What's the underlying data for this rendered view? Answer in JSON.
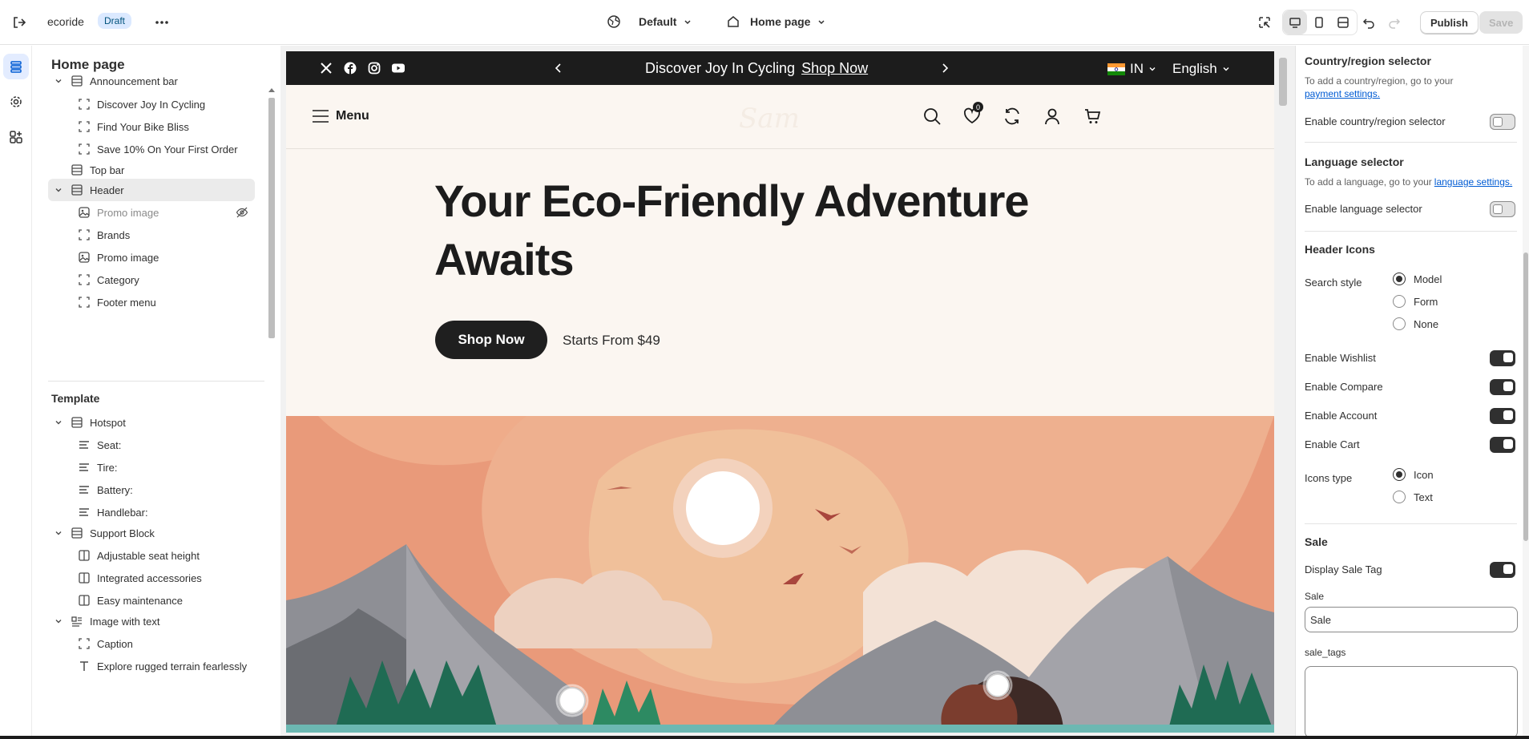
{
  "topbar": {
    "store_name": "ecoride",
    "status_badge": "Draft",
    "theme_selector": "Default",
    "page_selector": "Home page",
    "publish_label": "Publish",
    "save_label": "Save"
  },
  "rail": {
    "icons": [
      "sections-icon",
      "settings-gear-icon",
      "apps-icon"
    ]
  },
  "tree": {
    "title": "Home page",
    "header_group": [
      {
        "label": "Announcement bar",
        "level": 1,
        "expanded": true,
        "icon": "section-icon"
      },
      {
        "label": "Discover Joy In Cycling",
        "level": 2,
        "icon": "block-icon"
      },
      {
        "label": "Find Your Bike Bliss",
        "level": 2,
        "icon": "block-icon"
      },
      {
        "label": "Save 10% On Your First Order",
        "level": 2,
        "icon": "block-icon"
      },
      {
        "label": "Top bar",
        "level": 1,
        "icon": "section-icon"
      },
      {
        "label": "Header",
        "level": 1,
        "expanded": true,
        "selected": true,
        "icon": "section-icon"
      },
      {
        "label": "Promo image",
        "level": 2,
        "hidden": true,
        "icon": "image-icon"
      },
      {
        "label": "Brands",
        "level": 2,
        "icon": "block-icon"
      },
      {
        "label": "Promo image",
        "level": 2,
        "icon": "image-icon"
      },
      {
        "label": "Category",
        "level": 2,
        "icon": "block-icon"
      },
      {
        "label": "Footer menu",
        "level": 2,
        "icon": "block-icon"
      }
    ],
    "template_label": "Template",
    "template_items": [
      {
        "label": "Hotspot",
        "level": 1,
        "expanded": true,
        "icon": "section-icon"
      },
      {
        "label": "Seat:",
        "level": 2,
        "icon": "text-icon"
      },
      {
        "label": "Tire:",
        "level": 2,
        "icon": "text-icon"
      },
      {
        "label": "Battery:",
        "level": 2,
        "icon": "text-icon"
      },
      {
        "label": "Handlebar:",
        "level": 2,
        "icon": "text-icon"
      },
      {
        "label": "Support Block",
        "level": 1,
        "expanded": true,
        "icon": "section-icon"
      },
      {
        "label": "Adjustable seat height",
        "level": 2,
        "icon": "column-icon"
      },
      {
        "label": "Integrated accessories",
        "level": 2,
        "icon": "column-icon"
      },
      {
        "label": "Easy maintenance",
        "level": 2,
        "icon": "column-icon"
      },
      {
        "label": "Image with text",
        "level": 1,
        "expanded": true,
        "icon": "image-text-icon"
      },
      {
        "label": "Caption",
        "level": 2,
        "icon": "block-icon"
      },
      {
        "label": "Explore rugged terrain fearlessly",
        "level": 2,
        "icon": "heading-icon"
      }
    ]
  },
  "preview": {
    "announcement": {
      "text": "Discover Joy In Cycling",
      "link": "Shop Now",
      "country": "IN",
      "language": "English"
    },
    "header": {
      "menu_label": "Menu",
      "logo_text": "Sam",
      "wishlist_count": "0"
    },
    "hero": {
      "title": "Your Eco-Friendly Adventure Awaits",
      "button": "Shop Now",
      "subtext": "Starts From $49"
    }
  },
  "settings": {
    "country": {
      "heading": "Country/region selector",
      "help_prefix": "To add a country/region, go to your",
      "help_link": "payment settings.",
      "toggle_label": "Enable country/region selector",
      "enabled": false
    },
    "language": {
      "heading": "Language selector",
      "help_prefix": "To add a language, go to your",
      "help_link": "language settings.",
      "toggle_label": "Enable language selector",
      "enabled": false
    },
    "header_icons": {
      "heading": "Header Icons",
      "search_style_label": "Search style",
      "search_options": [
        "Model",
        "Form",
        "None"
      ],
      "search_selected": "Model",
      "wishlist_label": "Enable Wishlist",
      "compare_label": "Enable Compare",
      "account_label": "Enable Account",
      "cart_label": "Enable Cart",
      "icons_type_label": "Icons type",
      "icons_options": [
        "Icon",
        "Text"
      ],
      "icons_selected": "Icon"
    },
    "sale": {
      "heading": "Sale",
      "display_tag_label": "Display Sale Tag",
      "sale_field_label": "Sale",
      "sale_field_value": "Sale",
      "sale_tags_label": "sale_tags",
      "sale_tags_value": ""
    }
  },
  "colors": {
    "announcement_bg": "#1c1c1c",
    "hero_bg": "#fbf6f1",
    "illustration_sky": "#e99a7a",
    "badge_bg": "#dbe9ff",
    "toggle_on": "#303030"
  }
}
